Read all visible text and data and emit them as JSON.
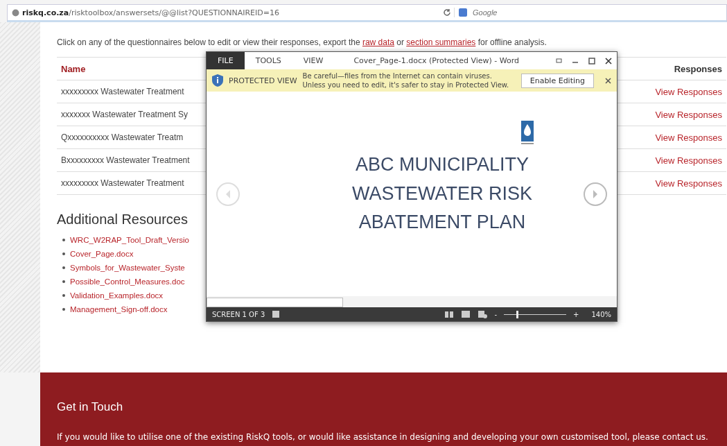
{
  "browser": {
    "url_host": "riskq.co.za",
    "url_path": "/risktoolbox/answersets/@@list?QUESTIONNAIREID=16",
    "search_placeholder": "Google"
  },
  "intro": {
    "text": "Click on any of the questionnaires below to edit or view their responses, export the ",
    "link1": "raw data",
    "middle": " or ",
    "link2": "section summaries",
    "end": " for offline analysis."
  },
  "table": {
    "columns": [
      "Name",
      "Responses"
    ],
    "rows": [
      {
        "name": "xxxxxxxxx Wastewater Treatment",
        "action": "View Responses"
      },
      {
        "name": "xxxxxxx Wastewater Treatment Sy",
        "action": "View Responses"
      },
      {
        "name": "Qxxxxxxxxxx Wastewater Treatm",
        "action": "View Responses"
      },
      {
        "name": "Bxxxxxxxxx Wastewater Treatment",
        "action": "View Responses"
      },
      {
        "name": "xxxxxxxxx Wastewater Treatment",
        "action": "View Responses"
      }
    ]
  },
  "resources": {
    "title": "Additional Resources",
    "links": [
      "WRC_W2RAP_Tool_Draft_Versio",
      "Cover_Page.docx",
      "Symbols_for_Wastewater_Syste",
      "Possible_Control_Measures.doc",
      "Validation_Examples.docx",
      "Management_Sign-off.docx"
    ]
  },
  "word": {
    "tabs": [
      {
        "label": "FILE",
        "selected": true
      },
      {
        "label": "TOOLS",
        "selected": false
      },
      {
        "label": "VIEW",
        "selected": false
      }
    ],
    "title": "Cover_Page-1.docx (Protected View) - Word",
    "banner": {
      "label": "PROTECTED VIEW",
      "message": "Be careful—files from the Internet can contain viruses. Unless you need to edit, it's safer to stay in Protected View.",
      "button": "Enable Editing"
    },
    "slide_lines": [
      "ABC MUNICIPALITY",
      "WASTEWATER RISK",
      "ABATEMENT PLAN"
    ],
    "status": {
      "screen": "SCREEN 1 OF 3",
      "zoom_out": "-",
      "zoom": {
        "level": 0.2
      },
      "zoom_in": "+",
      "zoom_text": "140%"
    }
  },
  "footer": {
    "title": "Get in Touch",
    "text": "If you would like to utilise one of the existing RiskQ tools, or would like assistance in designing and developing your own customised tool, please contact us."
  }
}
